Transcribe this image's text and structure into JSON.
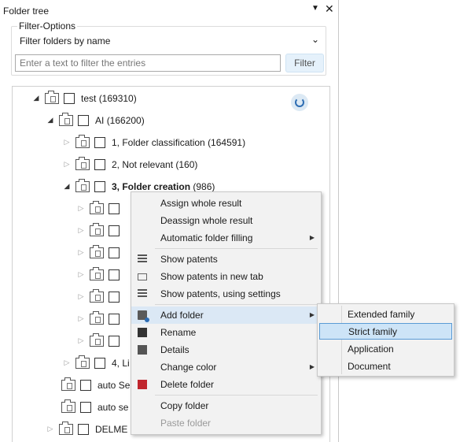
{
  "panel": {
    "title": "Folder tree",
    "pin_glyph": "▼",
    "close_glyph": "✕"
  },
  "filter": {
    "legend": "Filter-Options",
    "select_value": "Filter folders by name",
    "chevron_glyph": "⌄",
    "input_placeholder": "Enter a text to filter the entries",
    "input_value": "",
    "button_label": "Filter"
  },
  "tree": {
    "rows": [
      {
        "label": "test",
        "count": "(169310)",
        "expanded": true,
        "bold": false
      },
      {
        "label": "AI",
        "count": "(166200)",
        "expanded": true,
        "bold": false
      },
      {
        "label": "1, Folder classification",
        "count": "(164591)",
        "expanded": false,
        "bold": false
      },
      {
        "label": "2, Not relevant",
        "count": "(160)",
        "expanded": false,
        "bold": false
      },
      {
        "label": "3, Folder creation",
        "count": "(986)",
        "expanded": true,
        "bold": true
      },
      {
        "label": "",
        "count": "",
        "expanded": false
      },
      {
        "label": "",
        "count": "",
        "expanded": false
      },
      {
        "label": "",
        "count": "",
        "expanded": false
      },
      {
        "label": "",
        "count": "",
        "expanded": false
      },
      {
        "label": "",
        "count": "",
        "expanded": false
      },
      {
        "label": "",
        "count": "",
        "expanded": false
      },
      {
        "label": "",
        "count": "",
        "expanded": false
      },
      {
        "label": "4, Li",
        "count": "",
        "expanded": false
      },
      {
        "label": "auto Se",
        "count": "",
        "expanded": null
      },
      {
        "label": "auto se",
        "count": "",
        "expanded": null
      },
      {
        "label": "DELME",
        "count": "",
        "expanded": false
      }
    ],
    "expanded_glyph": "◢",
    "collapsed_glyph": "▷"
  },
  "context_menu": {
    "items": [
      {
        "label": "Assign whole result",
        "icon": null,
        "submenu": false
      },
      {
        "label": "Deassign whole result",
        "icon": null,
        "submenu": false
      },
      {
        "label": "Automatic folder filling",
        "icon": null,
        "submenu": true
      },
      {
        "label": "Show patents",
        "icon": "list-icon",
        "submenu": false
      },
      {
        "label": "Show patents in new tab",
        "icon": "new-tab-icon",
        "submenu": false
      },
      {
        "label": "Show patents, using settings",
        "icon": "list-settings-icon",
        "submenu": false
      },
      {
        "label": "Add folder",
        "icon": "folder-add-icon",
        "submenu": true,
        "highlighted": true
      },
      {
        "label": "Rename",
        "icon": "rename-icon",
        "submenu": false
      },
      {
        "label": "Details",
        "icon": "details-icon",
        "submenu": false
      },
      {
        "label": "Change color",
        "icon": null,
        "submenu": true
      },
      {
        "label": "Delete folder",
        "icon": "delete-folder-icon",
        "submenu": false
      },
      {
        "label": "Copy folder",
        "icon": null,
        "submenu": false
      },
      {
        "label": "Paste folder",
        "icon": null,
        "submenu": false,
        "disabled": true
      }
    ],
    "submenu_arrow_glyph": "▶"
  },
  "add_folder_submenu": {
    "items": [
      {
        "label": "Extended family"
      },
      {
        "label": "Strict family",
        "highlighted": true
      },
      {
        "label": "Application"
      },
      {
        "label": "Document"
      }
    ]
  },
  "colors": {
    "highlight": "#cde4f7",
    "highlight_border": "#5a9bd5",
    "menu_background": "#f2f2f2",
    "filter_button_background": "#e5f1fb",
    "delete_icon": "#c0262d"
  }
}
